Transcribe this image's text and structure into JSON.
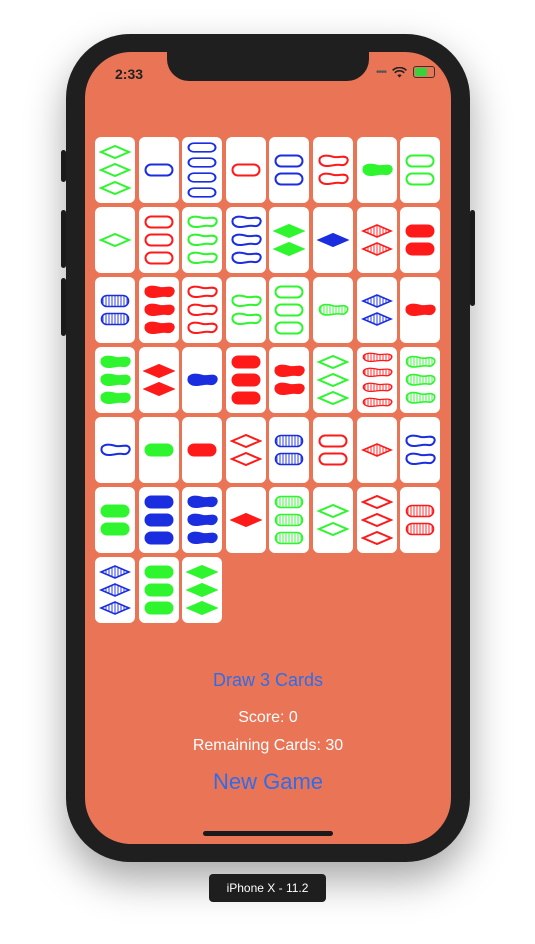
{
  "status_bar": {
    "time": "2:33",
    "signal_icon": "cell-signal-dots-icon",
    "wifi_icon": "wifi-icon",
    "battery_icon": "battery-charging-icon"
  },
  "colors": {
    "background": "#ea7556",
    "red": "#ff1a1a",
    "green": "#2ef52e",
    "blue": "#1a2ee0",
    "button": "#2f6ce9"
  },
  "cards": [
    {
      "n": 3,
      "shape": "diamond",
      "color": "green",
      "fill": "open"
    },
    {
      "n": 1,
      "shape": "oval",
      "color": "blue",
      "fill": "open"
    },
    {
      "n": 4,
      "shape": "oval",
      "color": "blue",
      "fill": "open"
    },
    {
      "n": 1,
      "shape": "oval",
      "color": "red",
      "fill": "open"
    },
    {
      "n": 2,
      "shape": "oval",
      "color": "blue",
      "fill": "open"
    },
    {
      "n": 2,
      "shape": "squiggle",
      "color": "red",
      "fill": "open"
    },
    {
      "n": 1,
      "shape": "squiggle",
      "color": "green",
      "fill": "solid"
    },
    {
      "n": 2,
      "shape": "oval",
      "color": "green",
      "fill": "open"
    },
    {
      "n": 1,
      "shape": "diamond",
      "color": "green",
      "fill": "open"
    },
    {
      "n": 3,
      "shape": "oval",
      "color": "red",
      "fill": "open"
    },
    {
      "n": 3,
      "shape": "squiggle",
      "color": "green",
      "fill": "open"
    },
    {
      "n": 3,
      "shape": "squiggle",
      "color": "blue",
      "fill": "open"
    },
    {
      "n": 2,
      "shape": "diamond",
      "color": "green",
      "fill": "solid"
    },
    {
      "n": 1,
      "shape": "diamond",
      "color": "blue",
      "fill": "solid"
    },
    {
      "n": 2,
      "shape": "diamond",
      "color": "red",
      "fill": "striped"
    },
    {
      "n": 2,
      "shape": "oval",
      "color": "red",
      "fill": "solid"
    },
    {
      "n": 2,
      "shape": "oval",
      "color": "blue",
      "fill": "striped"
    },
    {
      "n": 3,
      "shape": "squiggle",
      "color": "red",
      "fill": "solid"
    },
    {
      "n": 3,
      "shape": "squiggle",
      "color": "red",
      "fill": "open"
    },
    {
      "n": 2,
      "shape": "squiggle",
      "color": "green",
      "fill": "open"
    },
    {
      "n": 3,
      "shape": "oval",
      "color": "green",
      "fill": "open"
    },
    {
      "n": 1,
      "shape": "squiggle",
      "color": "green",
      "fill": "striped"
    },
    {
      "n": 2,
      "shape": "diamond",
      "color": "blue",
      "fill": "striped"
    },
    {
      "n": 1,
      "shape": "squiggle",
      "color": "red",
      "fill": "solid"
    },
    {
      "n": 3,
      "shape": "squiggle",
      "color": "green",
      "fill": "solid"
    },
    {
      "n": 2,
      "shape": "diamond",
      "color": "red",
      "fill": "solid"
    },
    {
      "n": 1,
      "shape": "squiggle",
      "color": "blue",
      "fill": "solid"
    },
    {
      "n": 3,
      "shape": "oval",
      "color": "red",
      "fill": "solid"
    },
    {
      "n": 2,
      "shape": "squiggle",
      "color": "red",
      "fill": "solid"
    },
    {
      "n": 3,
      "shape": "diamond",
      "color": "green",
      "fill": "open"
    },
    {
      "n": 4,
      "shape": "squiggle",
      "color": "red",
      "fill": "striped"
    },
    {
      "n": 3,
      "shape": "squiggle",
      "color": "green",
      "fill": "striped"
    },
    {
      "n": 1,
      "shape": "squiggle",
      "color": "blue",
      "fill": "open"
    },
    {
      "n": 1,
      "shape": "oval",
      "color": "green",
      "fill": "solid"
    },
    {
      "n": 1,
      "shape": "oval",
      "color": "red",
      "fill": "solid"
    },
    {
      "n": 2,
      "shape": "diamond",
      "color": "red",
      "fill": "open"
    },
    {
      "n": 2,
      "shape": "oval",
      "color": "blue",
      "fill": "striped"
    },
    {
      "n": 2,
      "shape": "oval",
      "color": "red",
      "fill": "open"
    },
    {
      "n": 1,
      "shape": "diamond",
      "color": "red",
      "fill": "striped"
    },
    {
      "n": 2,
      "shape": "squiggle",
      "color": "blue",
      "fill": "open"
    },
    {
      "n": 2,
      "shape": "oval",
      "color": "green",
      "fill": "solid"
    },
    {
      "n": 3,
      "shape": "oval",
      "color": "blue",
      "fill": "solid"
    },
    {
      "n": 3,
      "shape": "squiggle",
      "color": "blue",
      "fill": "solid"
    },
    {
      "n": 1,
      "shape": "diamond",
      "color": "red",
      "fill": "solid"
    },
    {
      "n": 3,
      "shape": "oval",
      "color": "green",
      "fill": "striped"
    },
    {
      "n": 2,
      "shape": "diamond",
      "color": "green",
      "fill": "open"
    },
    {
      "n": 3,
      "shape": "diamond",
      "color": "red",
      "fill": "open"
    },
    {
      "n": 2,
      "shape": "oval",
      "color": "red",
      "fill": "striped"
    },
    {
      "n": 3,
      "shape": "diamond",
      "color": "blue",
      "fill": "striped"
    },
    {
      "n": 3,
      "shape": "oval",
      "color": "green",
      "fill": "solid"
    },
    {
      "n": 3,
      "shape": "diamond",
      "color": "green",
      "fill": "solid"
    }
  ],
  "controls": {
    "draw_label": "Draw 3 Cards",
    "score_text": "Score: 0",
    "remaining_text": "Remaining Cards: 30",
    "new_game_label": "New Game"
  },
  "device_label": "iPhone X - 11.2"
}
